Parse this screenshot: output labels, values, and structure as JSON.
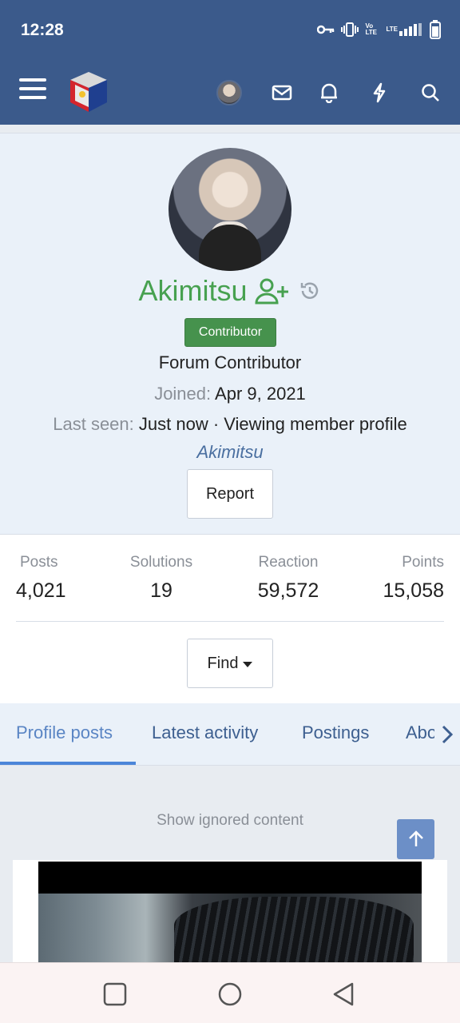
{
  "status_bar": {
    "time": "12:28",
    "icons": [
      "vpn-key-icon",
      "vibrate-icon",
      "volte-icon",
      "lte-signal-icon",
      "battery-icon"
    ],
    "volte_label": "Vo LTE",
    "lte_label": "LTE"
  },
  "header": {
    "icons": [
      "menu-icon",
      "site-logo",
      "user-avatar",
      "mail-icon",
      "bell-icon",
      "lightning-icon",
      "search-icon"
    ]
  },
  "profile": {
    "username": "Akimitsu",
    "badge": "Contributor",
    "user_title": "Forum Contributor",
    "joined_label": "Joined:",
    "joined_value": "Apr 9, 2021",
    "last_seen_label": "Last seen:",
    "last_seen_value": "Just now · Viewing member profile",
    "viewing_member": "Akimitsu",
    "report_label": "Report"
  },
  "stats": [
    {
      "label": "Posts",
      "value": "4,021"
    },
    {
      "label": "Solutions",
      "value": "19"
    },
    {
      "label": "Reaction",
      "value": "59,572"
    },
    {
      "label": "Points",
      "value": "15,058"
    }
  ],
  "find_label": "Find",
  "tabs": [
    {
      "label": "Profile posts",
      "active": true
    },
    {
      "label": "Latest activity",
      "active": false
    },
    {
      "label": "Postings",
      "active": false
    },
    {
      "label": "About",
      "active": false
    }
  ],
  "content": {
    "show_ignored": "Show ignored content"
  },
  "colors": {
    "header_bg": "#3b5a8b",
    "username_green": "#47a150",
    "badge_green": "#46924d",
    "link_blue": "#4a6fa0",
    "tab_active": "#5a85c4"
  }
}
